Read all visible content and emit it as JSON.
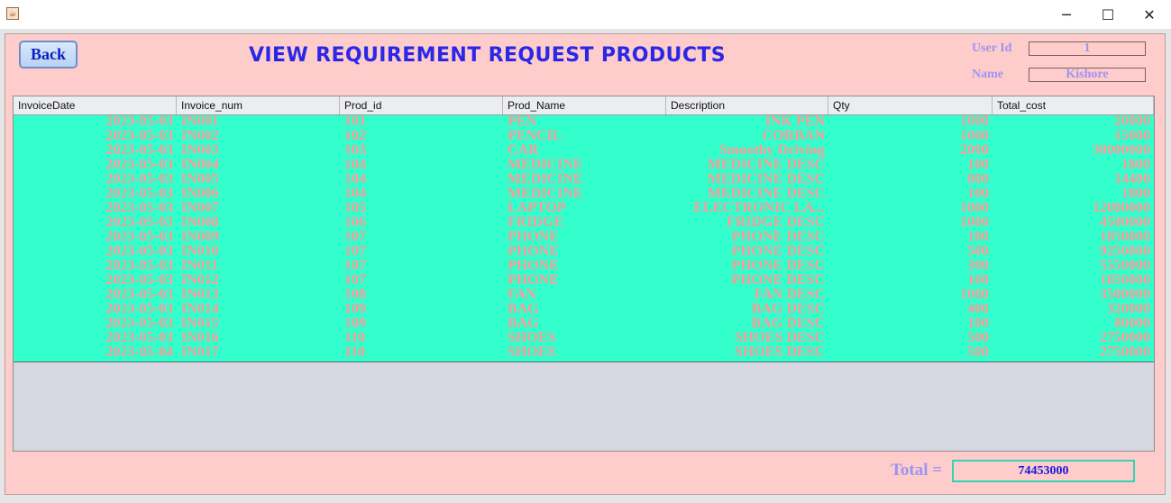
{
  "window": {
    "minimize_glyph": "─",
    "maximize_glyph": "☐",
    "close_glyph": "✕",
    "app_icon": "java-cup-icon"
  },
  "header": {
    "back_label": "Back",
    "title": "VIEW REQUIREMENT REQUEST PRODUCTS",
    "user_id_label": "User Id",
    "user_id_value": "1",
    "name_label": "Name",
    "name_value": "Kishore"
  },
  "table": {
    "columns": [
      "InvoiceDate",
      "Invoice_num",
      "Prod_id",
      "Prod_Name",
      "Description",
      "Qty",
      "Total_cost"
    ],
    "rows": [
      [
        "2023-05-03",
        "IN001",
        "101",
        "PEN",
        "INK PEN",
        "1000",
        "20000"
      ],
      [
        "2023-05-03",
        "IN002",
        "102",
        "PENCIL",
        "CORBAN",
        "1000",
        "15000"
      ],
      [
        "2023-05-03",
        "IN003",
        "103",
        "CAR",
        "Smoothy Driving",
        "2000",
        "30000000"
      ],
      [
        "2023-05-03",
        "IN004",
        "104",
        "MEDICINE",
        "MEDICINE DESC",
        "100",
        "1800"
      ],
      [
        "2023-05-03",
        "IN005",
        "104",
        "MEDICINE",
        "MEDICINE DESC",
        "800",
        "14400"
      ],
      [
        "2023-05-03",
        "IN006",
        "104",
        "MEDICINE",
        "MEDICINE DESC",
        "100",
        "1800"
      ],
      [
        "2023-05-03",
        "IN007",
        "105",
        "LAPTOP",
        "ELECTRONIC LA...",
        "1000",
        "12000000"
      ],
      [
        "2023-05-03",
        "IN008",
        "106",
        "FRIDGE",
        "FRIDGE DESC",
        "1000",
        "4500000"
      ],
      [
        "2023-05-03",
        "IN009",
        "107",
        "PHONE",
        "PHONE DESC",
        "100",
        "1850000"
      ],
      [
        "2023-05-03",
        "IN010",
        "107",
        "PHONE",
        "PHONE DESC",
        "500",
        "9250000"
      ],
      [
        "2023-05-03",
        "IN011",
        "107",
        "PHONE",
        "PHONE DESC",
        "300",
        "5550000"
      ],
      [
        "2023-05-03",
        "IN012",
        "107",
        "PHONE",
        "PHONE DESC",
        "100",
        "1850000"
      ],
      [
        "2023-05-03",
        "IN013",
        "108",
        "FAN",
        "FAN DESC",
        "1000",
        "3500000"
      ],
      [
        "2023-05-03",
        "IN014",
        "109",
        "BAG",
        "BAG DESC",
        "400",
        "320000"
      ],
      [
        "2023-05-03",
        "IN015",
        "109",
        "BAG",
        "BAG DESC",
        "100",
        "80000"
      ],
      [
        "2023-05-03",
        "IN016",
        "110",
        "SHOES",
        "SHOES DESC",
        "500",
        "2750000"
      ],
      [
        "2023-05-04",
        "IN017",
        "110",
        "SHOES",
        "SHOES DESC",
        "500",
        "2750000"
      ]
    ],
    "colors": {
      "row_background": "#33ffcc",
      "row_text": "#ff9999",
      "empty_area": "#d6d7e0"
    }
  },
  "footer": {
    "total_label": "Total =",
    "total_value": "74453000"
  },
  "colors": {
    "panel_background": "#ffcccc",
    "title_color": "#2a28e6",
    "label_color": "#9d93f2"
  }
}
